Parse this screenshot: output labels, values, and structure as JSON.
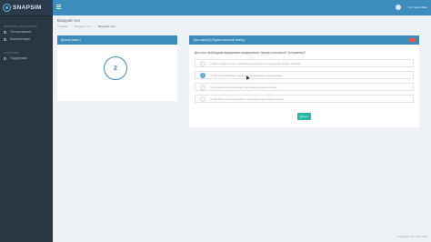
{
  "app": {
    "logo_text": "SNAPSIM"
  },
  "sidebar": {
    "section1": "ВЫБЕРИТЕ ОБРАЗОВАНИЕ",
    "items": [
      {
        "label": "Тестирование"
      },
      {
        "label": "Компетенции"
      }
    ],
    "section2": "НАСТРОЙКИ",
    "items2": [
      {
        "label": "Поддержка"
      }
    ]
  },
  "topbar": {
    "user_name": "Тестовый Иван"
  },
  "page": {
    "title": "Входной тест",
    "breadcrumb": [
      "Главная",
      "Входной тест",
      "Входной тест"
    ]
  },
  "timer_panel": {
    "header": "Время (мин.)",
    "value": "2"
  },
  "question_panel": {
    "header": "Три-карта(с) Единственный выбор",
    "question": "Для чего необходимо вжержимать выдерживать \"время отклонения\" (в герметке)?",
    "options": [
      {
        "text": "Чтобы \"герметичность\" добились целостности и выдачи желаемого трафика",
        "checked": false
      },
      {
        "text": "Чтобы контролировать модель и направление коммуникации",
        "checked": true
      },
      {
        "text": "Чтобы выполнять процедуру на нижнем уровне системы",
        "checked": false
      },
      {
        "text": "Чтобы было никаких ошибок в приложении до загрузки кожуху",
        "checked": false
      }
    ],
    "submit_label": "Далее"
  },
  "footer": {
    "text": "SnapSim© Ltd. 2014-2020"
  },
  "colors": {
    "accent": "#3c8dbc",
    "sidebar": "#2b3643",
    "submit": "#2bb6a3",
    "danger": "#e05b4b"
  }
}
